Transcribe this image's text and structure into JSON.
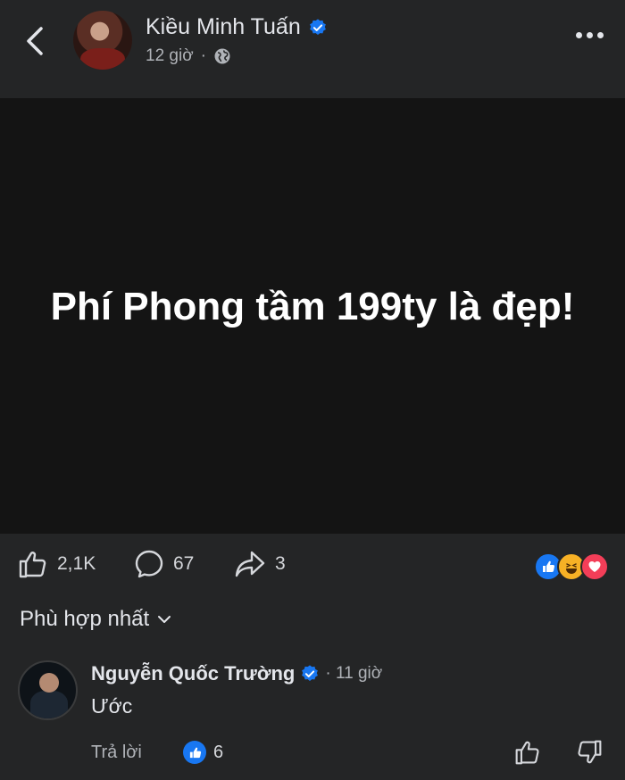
{
  "header": {
    "author_name": "Kiều Minh Tuấn",
    "time": "12 giờ",
    "separator": "·",
    "icons": {
      "back": "chevron-left-icon",
      "verified": "verified-badge-icon",
      "audience": "globe-icon",
      "more": "more-horizontal-icon"
    }
  },
  "post": {
    "text": "Phí Phong tầm 199ty là đẹp!",
    "background": "#141414"
  },
  "actions": {
    "likes": "2,1K",
    "comments": "67",
    "shares": "3",
    "reactions": [
      "like",
      "haha",
      "love"
    ]
  },
  "comments_section": {
    "sort_label": "Phù hợp nhất",
    "comment": {
      "author": "Nguyễn Quốc Trường",
      "time": "· 11 giờ",
      "text": "Ước",
      "reply_label": "Trả lời",
      "like_count": "6"
    }
  },
  "colors": {
    "accent": "#1877f2",
    "surface": "#242526",
    "text": "#e4e6eb",
    "muted": "#b0b3b8",
    "love": "#f33e58",
    "haha": "#f7b125"
  }
}
